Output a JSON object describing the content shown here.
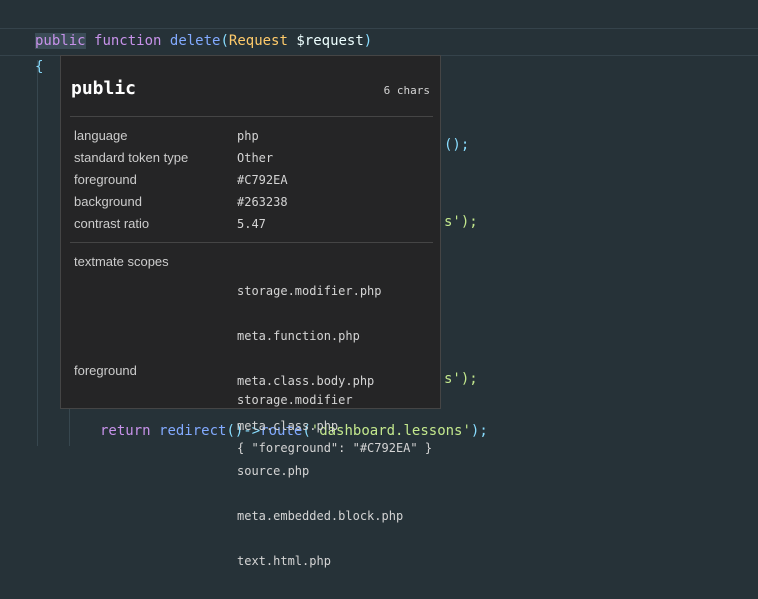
{
  "code": {
    "line1": {
      "kw1": "public",
      "kw2": "function",
      "fn": "delete",
      "p1": "(",
      "cls": "Request",
      "var": "$request",
      "p2": ")"
    },
    "brace_open": "{",
    "frag_a": "();",
    "frag_b": "s');",
    "frag_c": "s');",
    "frag_d": "})",
    "last": {
      "kw": "return",
      "fn1": "redirect",
      "p1": "()->",
      "fn2": "route",
      "p2": "(",
      "str": "'dashboard.lessons'",
      "p3": ");"
    }
  },
  "hover": {
    "title": "public",
    "char_count": "6 chars",
    "rows": [
      {
        "label": "language",
        "value": "php"
      },
      {
        "label": "standard token type",
        "value": "Other"
      },
      {
        "label": "foreground",
        "value": "#C792EA"
      },
      {
        "label": "background",
        "value": "#263238"
      },
      {
        "label": "contrast ratio",
        "value": "5.47"
      }
    ],
    "scopes_label": "textmate scopes",
    "scopes": [
      "storage.modifier.php",
      "meta.function.php",
      "meta.class.body.php",
      "meta.class.php",
      "source.php",
      "meta.embedded.block.php",
      "text.html.php"
    ],
    "fg_label": "foreground",
    "fg_scope": "storage.modifier",
    "fg_rule": "{ \"foreground\": \"#C792EA\" }"
  },
  "colors": {
    "editor_bg": "#263238",
    "keyword": "#C792EA",
    "function": "#82AAFF",
    "class": "#FFCB6B",
    "string": "#C3E88D",
    "punctuation": "#89DDFF",
    "hover_bg": "#252526"
  }
}
